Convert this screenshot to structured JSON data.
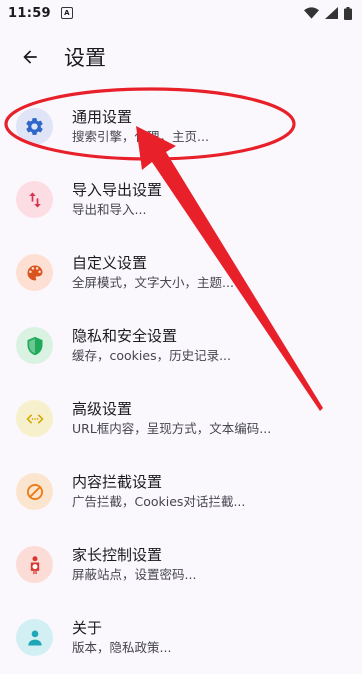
{
  "status": {
    "time": "11:59",
    "notification_glyph": "A"
  },
  "header": {
    "title": "设置"
  },
  "settings": [
    {
      "title": "通用设置",
      "subtitle": "搜索引擎，代理，主页...",
      "icon": "gear-icon",
      "icon_bg": "#dfe4f7",
      "icon_color": "#2e67c9"
    },
    {
      "title": "导入导出设置",
      "subtitle": "导出和导入...",
      "icon": "import-export-icon",
      "icon_bg": "#fbdde3",
      "icon_color": "#d5304d"
    },
    {
      "title": "自定义设置",
      "subtitle": "全屏模式，文字大小，主题...",
      "icon": "palette-icon",
      "icon_bg": "#fde0d3",
      "icon_color": "#d8531e"
    },
    {
      "title": "隐私和安全设置",
      "subtitle": "缓存，cookies，历史记录...",
      "icon": "shield-icon",
      "icon_bg": "#d9f2e2",
      "icon_color": "#1faa59"
    },
    {
      "title": "高级设置",
      "subtitle": "URL框内容，呈现方式，文本编码...",
      "icon": "code-icon",
      "icon_bg": "#f6f0cc",
      "icon_color": "#d4a400"
    },
    {
      "title": "内容拦截设置",
      "subtitle": "广告拦截，Cookies对话拦截...",
      "icon": "block-icon",
      "icon_bg": "#fbe5cf",
      "icon_color": "#ec7a14"
    },
    {
      "title": "家长控制设置",
      "subtitle": "屏蔽站点，设置密码...",
      "icon": "child-icon",
      "icon_bg": "#fcdcd6",
      "icon_color": "#d7372f"
    },
    {
      "title": "关于",
      "subtitle": "版本，隐私政策...",
      "icon": "info-person-icon",
      "icon_bg": "#d2f0f3",
      "icon_color": "#1fa6b7"
    }
  ],
  "annotation": {
    "color": "#e8202a"
  }
}
